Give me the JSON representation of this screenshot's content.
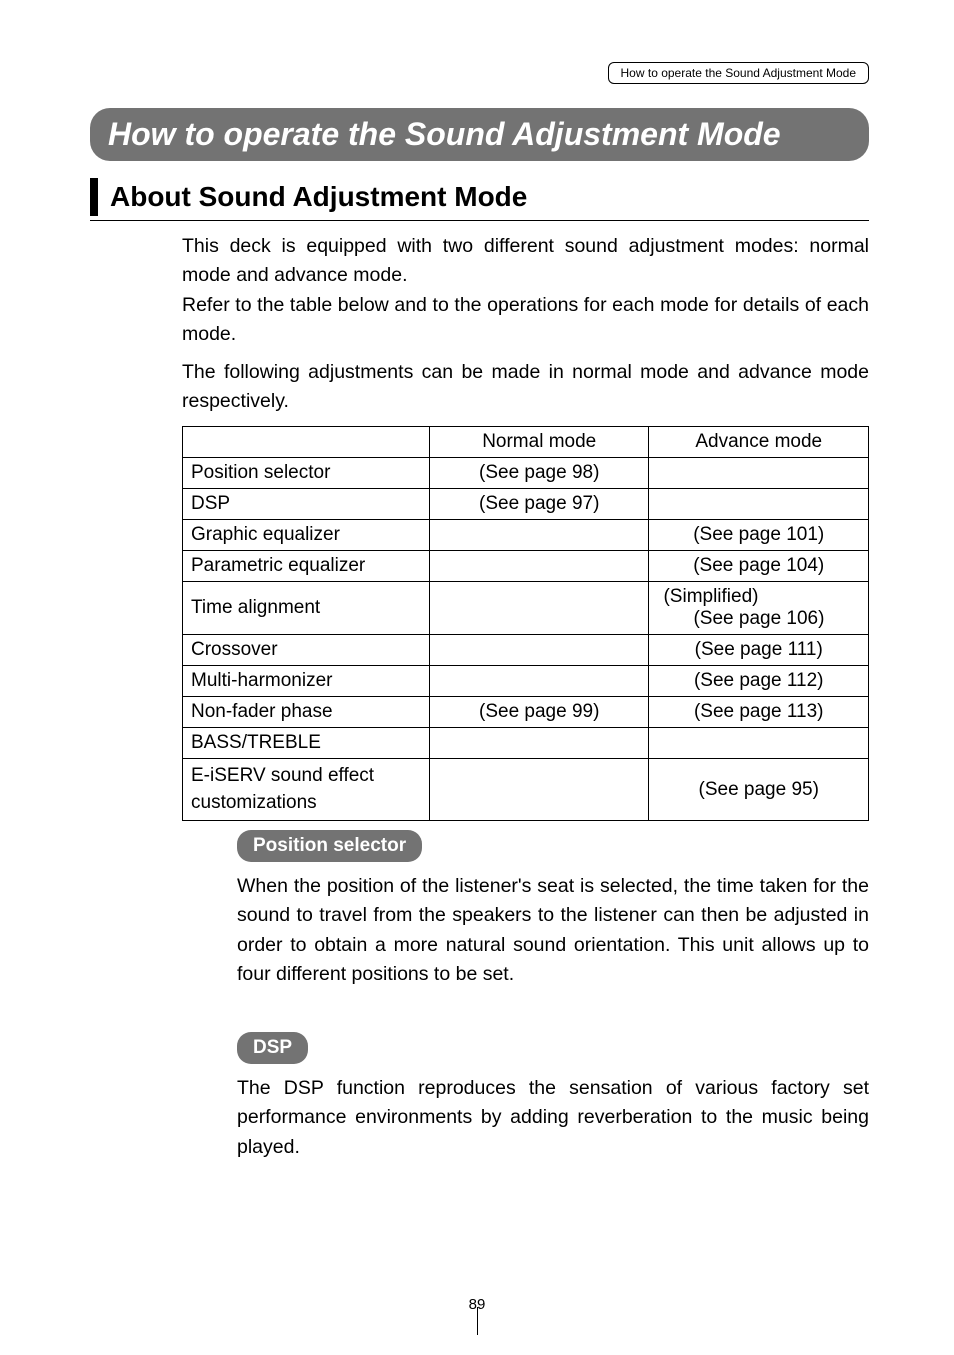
{
  "header": {
    "breadcrumb": "How to operate the Sound Adjustment Mode"
  },
  "title": "How to operate the Sound Adjustment Mode",
  "section_heading": "About Sound Adjustment Mode",
  "intro1": "This deck is equipped with two different sound adjustment modes: normal mode and advance mode.",
  "intro2": "Refer to the table below and to the operations for each mode for details of each mode.",
  "intro3": "The following adjustments can be made in normal mode and advance mode respectively.",
  "table": {
    "header": {
      "c1": "",
      "c2": "Normal mode",
      "c3": "Advance mode"
    },
    "rows": [
      {
        "c1": "Position selector",
        "c2": "(See page 98)",
        "c3": ""
      },
      {
        "c1": "DSP",
        "c2": "(See page 97)",
        "c3": ""
      },
      {
        "c1": "Graphic equalizer",
        "c2": "",
        "c3": "(See page 101)"
      },
      {
        "c1": "Parametric equalizer",
        "c2": "",
        "c3": "(See page 104)"
      },
      {
        "c1": "Time alignment",
        "c2": "",
        "c3_l1": "(Simplified)",
        "c3_l2": "(See page 106)"
      },
      {
        "c1": "Crossover",
        "c2": "",
        "c3": "(See page 111)"
      },
      {
        "c1": "Multi-harmonizer",
        "c2": "",
        "c3": "(See page 112)"
      },
      {
        "c1": "Non-fader phase",
        "c2": "(See page 99)",
        "c3": "(See page 113)"
      },
      {
        "c1": "BASS/TREBLE",
        "c2": "",
        "c3": ""
      },
      {
        "c1": "E-iSERV sound effect customizations",
        "c2": "",
        "c3": "(See page 95)"
      }
    ]
  },
  "position_selector": {
    "heading": "Position selector",
    "body": "When the position of the listener's seat is selected, the time taken for the sound to travel from the speakers to the listener can then be adjusted in order to obtain a more natural sound orientation. This unit allows up to four different positions to be set."
  },
  "dsp": {
    "heading": "DSP",
    "body": "The DSP function reproduces the sensation of various factory set performance environments by adding reverberation to the music being played."
  },
  "page_number": "89"
}
